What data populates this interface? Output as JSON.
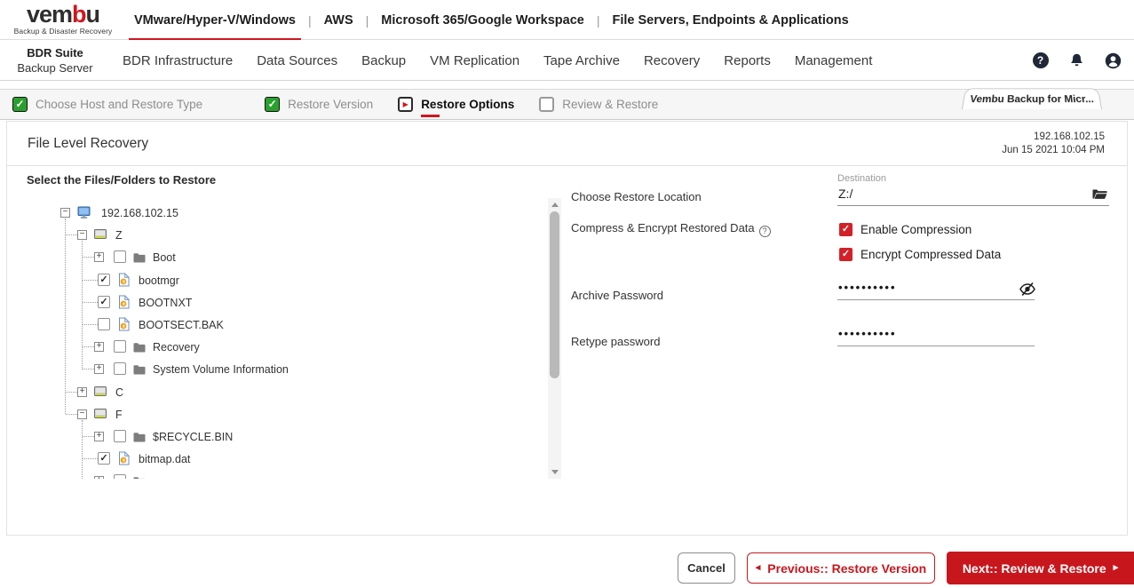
{
  "brand": {
    "name": "vembu",
    "tagline": "Backup & Disaster Recovery"
  },
  "product_nav": {
    "items": [
      {
        "label": "VMware/Hyper-V/Windows",
        "active": true
      },
      {
        "label": "AWS",
        "active": false
      },
      {
        "label": "Microsoft 365/Google Workspace",
        "active": false
      },
      {
        "label": "File Servers, Endpoints & Applications",
        "active": false
      }
    ]
  },
  "app_nav": {
    "suite": "BDR Suite",
    "server": "Backup Server",
    "items": [
      "BDR Infrastructure",
      "Data Sources",
      "Backup",
      "VM Replication",
      "Tape Archive",
      "Recovery",
      "Reports",
      "Management"
    ],
    "icons": [
      "help-icon",
      "notifications-icon",
      "user-icon"
    ]
  },
  "wizard": {
    "steps": [
      {
        "label": "Choose Host and Restore Type",
        "state": "done"
      },
      {
        "label": "Restore Version",
        "state": "done"
      },
      {
        "label": "Restore Options",
        "state": "active"
      },
      {
        "label": "Review & Restore",
        "state": "pending"
      }
    ],
    "session_tab": "Vembu Backup for Micr..."
  },
  "page": {
    "title": "File Level Recovery",
    "host": "192.168.102.15",
    "datetime": "Jun 15 2021 10:04 PM"
  },
  "tree": {
    "heading": "Select the Files/Folders to Restore",
    "rows": [
      {
        "type": "host",
        "expander": "minus",
        "label": "192.168.102.15"
      },
      {
        "type": "drive",
        "expander": "minus",
        "label": "Z"
      },
      {
        "type": "folder",
        "expander": "plus",
        "checked": false,
        "label": "Boot"
      },
      {
        "type": "file",
        "checked": true,
        "label": "bootmgr"
      },
      {
        "type": "file",
        "checked": true,
        "label": "BOOTNXT"
      },
      {
        "type": "file",
        "checked": false,
        "label": "BOOTSECT.BAK"
      },
      {
        "type": "folder",
        "expander": "plus",
        "checked": false,
        "label": "Recovery"
      },
      {
        "type": "folder",
        "expander": "plus",
        "checked": false,
        "label": "System Volume Information"
      },
      {
        "type": "drive",
        "expander": "plus",
        "label": "C"
      },
      {
        "type": "drive",
        "expander": "minus",
        "label": "F"
      },
      {
        "type": "folder",
        "expander": "plus",
        "checked": false,
        "label": "$RECYCLE.BIN"
      },
      {
        "type": "file",
        "checked": true,
        "label": "bitmap.dat"
      },
      {
        "type": "folder",
        "expander": "plus",
        "checked": false,
        "label": ""
      }
    ]
  },
  "options": {
    "location_label": "Choose Restore Location",
    "destination_label": "Destination",
    "destination_value": "Z:/",
    "compress_label": "Compress & Encrypt Restored Data",
    "help_glyph": "?",
    "checkboxes": [
      {
        "label": "Enable Compression",
        "checked": true
      },
      {
        "label": "Encrypt Compressed Data",
        "checked": true
      }
    ],
    "archive_password_label": "Archive Password",
    "archive_password_value": "••••••••••",
    "retype_password_label": "Retype password",
    "retype_password_value": "••••••••••"
  },
  "actions": {
    "cancel": "Cancel",
    "previous": "Previous:: Restore Version",
    "next": "Next:: Review & Restore"
  },
  "colors": {
    "accent_red": "#d0161d",
    "checkbox_red": "#d32128",
    "step_green": "#2aa02e",
    "steps_bar_bg": "#f6f6f6"
  }
}
